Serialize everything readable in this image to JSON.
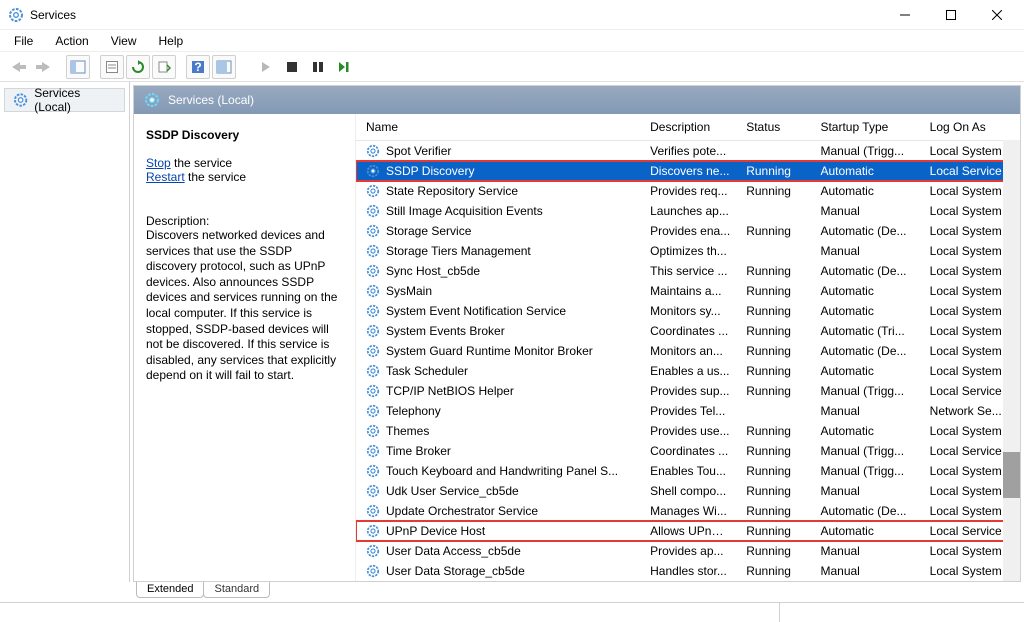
{
  "window": {
    "title": "Services"
  },
  "menu": {
    "file": "File",
    "action": "Action",
    "view": "View",
    "help": "Help"
  },
  "tree": {
    "root": "Services (Local)"
  },
  "panel_header": "Services (Local)",
  "details": {
    "title": "SSDP Discovery",
    "stop": "Stop",
    "restart": "Restart",
    "after_stop": " the service",
    "after_restart": " the service",
    "desc_label": "Description:",
    "desc": "Discovers networked devices and services that use the SSDP discovery protocol, such as UPnP devices. Also announces SSDP devices and services running on the local computer. If this service is stopped, SSDP-based devices will not be discovered. If this service is disabled, any services that explicitly depend on it will fail to start."
  },
  "columns": {
    "name": "Name",
    "desc": "Description",
    "status": "Status",
    "startup": "Startup Type",
    "logon": "Log On As"
  },
  "tabs": {
    "extended": "Extended",
    "standard": "Standard"
  },
  "rows": [
    {
      "name": "Spot Verifier",
      "desc": "Verifies pote...",
      "status": "",
      "startup": "Manual (Trigg...",
      "logon": "Local System",
      "selected": false
    },
    {
      "name": "SSDP Discovery",
      "desc": "Discovers ne...",
      "status": "Running",
      "startup": "Automatic",
      "logon": "Local Service",
      "selected": true,
      "highlight": true
    },
    {
      "name": "State Repository Service",
      "desc": "Provides req...",
      "status": "Running",
      "startup": "Automatic",
      "logon": "Local System"
    },
    {
      "name": "Still Image Acquisition Events",
      "desc": "Launches ap...",
      "status": "",
      "startup": "Manual",
      "logon": "Local System"
    },
    {
      "name": "Storage Service",
      "desc": "Provides ena...",
      "status": "Running",
      "startup": "Automatic (De...",
      "logon": "Local System"
    },
    {
      "name": "Storage Tiers Management",
      "desc": "Optimizes th...",
      "status": "",
      "startup": "Manual",
      "logon": "Local System"
    },
    {
      "name": "Sync Host_cb5de",
      "desc": "This service ...",
      "status": "Running",
      "startup": "Automatic (De...",
      "logon": "Local System"
    },
    {
      "name": "SysMain",
      "desc": "Maintains a...",
      "status": "Running",
      "startup": "Automatic",
      "logon": "Local System"
    },
    {
      "name": "System Event Notification Service",
      "desc": "Monitors sy...",
      "status": "Running",
      "startup": "Automatic",
      "logon": "Local System"
    },
    {
      "name": "System Events Broker",
      "desc": "Coordinates ...",
      "status": "Running",
      "startup": "Automatic (Tri...",
      "logon": "Local System"
    },
    {
      "name": "System Guard Runtime Monitor Broker",
      "desc": "Monitors an...",
      "status": "Running",
      "startup": "Automatic (De...",
      "logon": "Local System"
    },
    {
      "name": "Task Scheduler",
      "desc": "Enables a us...",
      "status": "Running",
      "startup": "Automatic",
      "logon": "Local System"
    },
    {
      "name": "TCP/IP NetBIOS Helper",
      "desc": "Provides sup...",
      "status": "Running",
      "startup": "Manual (Trigg...",
      "logon": "Local Service"
    },
    {
      "name": "Telephony",
      "desc": "Provides Tel...",
      "status": "",
      "startup": "Manual",
      "logon": "Network Se..."
    },
    {
      "name": "Themes",
      "desc": "Provides use...",
      "status": "Running",
      "startup": "Automatic",
      "logon": "Local System"
    },
    {
      "name": "Time Broker",
      "desc": "Coordinates ...",
      "status": "Running",
      "startup": "Manual (Trigg...",
      "logon": "Local Service"
    },
    {
      "name": "Touch Keyboard and Handwriting Panel S...",
      "desc": "Enables Tou...",
      "status": "Running",
      "startup": "Manual (Trigg...",
      "logon": "Local System"
    },
    {
      "name": "Udk User Service_cb5de",
      "desc": "Shell compo...",
      "status": "Running",
      "startup": "Manual",
      "logon": "Local System"
    },
    {
      "name": "Update Orchestrator Service",
      "desc": "Manages Wi...",
      "status": "Running",
      "startup": "Automatic (De...",
      "logon": "Local System"
    },
    {
      "name": "UPnP Device Host",
      "desc": "Allows UPnP ...",
      "status": "Running",
      "startup": "Automatic",
      "logon": "Local Service",
      "highlight": true
    },
    {
      "name": "User Data Access_cb5de",
      "desc": "Provides ap...",
      "status": "Running",
      "startup": "Manual",
      "logon": "Local System"
    },
    {
      "name": "User Data Storage_cb5de",
      "desc": "Handles stor...",
      "status": "Running",
      "startup": "Manual",
      "logon": "Local System"
    }
  ]
}
